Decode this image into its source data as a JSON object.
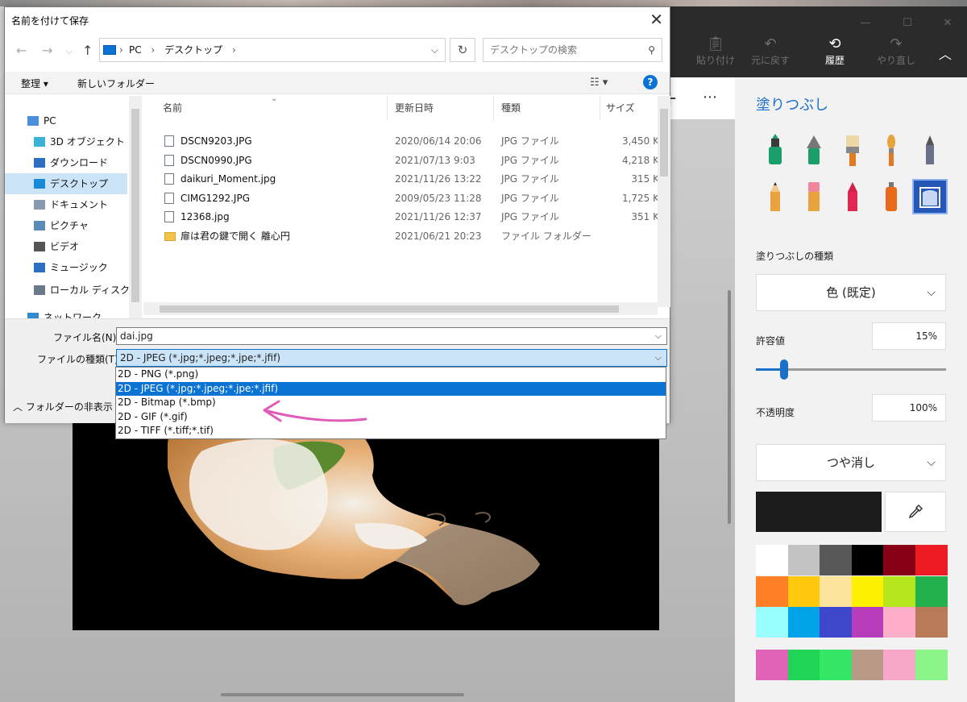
{
  "dialog": {
    "title": "名前を付けて保存",
    "address": [
      "PC",
      "デスクトップ"
    ],
    "search_placeholder": "デスクトップの検索",
    "commands": {
      "organize": "整理 ▾",
      "new_folder": "新しいフォルダー"
    },
    "nav_items": [
      {
        "label": "PC",
        "icon": "pc-icon"
      },
      {
        "label": "3D オブジェクト",
        "icon": "3d-objects-icon"
      },
      {
        "label": "ダウンロード",
        "icon": "download-icon"
      },
      {
        "label": "デスクトップ",
        "icon": "desktop-icon",
        "selected": true
      },
      {
        "label": "ドキュメント",
        "icon": "document-icon"
      },
      {
        "label": "ピクチャ",
        "icon": "pictures-icon"
      },
      {
        "label": "ビデオ",
        "icon": "video-icon"
      },
      {
        "label": "ミュージック",
        "icon": "music-icon"
      },
      {
        "label": "ローカル ディスク (C",
        "icon": "disk-icon"
      },
      {
        "label": "ネットワーク",
        "icon": "network-icon"
      }
    ],
    "columns": {
      "name": "名前",
      "modified": "更新日時",
      "type": "種類",
      "size": "サイズ"
    },
    "files": [
      {
        "name": "DSCN9203.JPG",
        "modified": "2020/06/14 20:06",
        "type": "JPG ファイル",
        "size": "3,450 K"
      },
      {
        "name": "DSCN0990.JPG",
        "modified": "2021/07/13 9:03",
        "type": "JPG ファイル",
        "size": "4,218 K"
      },
      {
        "name": "daikuri_Moment.jpg",
        "modified": "2021/11/26 13:22",
        "type": "JPG ファイル",
        "size": "315 K"
      },
      {
        "name": "CIMG1292.JPG",
        "modified": "2009/05/23 11:28",
        "type": "JPG ファイル",
        "size": "1,725 K"
      },
      {
        "name": "12368.jpg",
        "modified": "2021/11/26 12:37",
        "type": "JPG ファイル",
        "size": "351 K"
      },
      {
        "name": "扉は君の鍵で開く 離心円",
        "modified": "2021/06/21 20:23",
        "type": "ファイル フォルダー",
        "size": "",
        "folder": true
      }
    ],
    "filename_label": "ファイル名(N):",
    "filename_value": "dai.jpg",
    "filetype_label": "ファイルの種類(T):",
    "filetype_value": "2D - JPEG (*.jpg;*.jpeg;*.jpe;*.jfif)",
    "filetype_options": [
      "2D - PNG (*.png)",
      "2D - JPEG (*.jpg;*.jpeg;*.jpe;*.jfif)",
      "2D - Bitmap (*.bmp)",
      "2D - GIF (*.gif)",
      "2D - TIFF (*.tiff;*.tif)"
    ],
    "filetype_selected_index": 1,
    "hide_folders": "フォルダーの非表示"
  },
  "toolbar": {
    "paste": "貼り付け",
    "undo": "元に戻す",
    "history": "履歴",
    "redo": "やり直し"
  },
  "panel": {
    "title": "塗りつぶし",
    "fill_type_label": "塗りつぶしの種類",
    "fill_type_value": "色 (既定)",
    "tolerance_label": "許容値",
    "tolerance_value": "15%",
    "tolerance_level": 0.15,
    "opacity_label": "不透明度",
    "opacity_value": "100%",
    "finish_value": "つや消し",
    "current_color": "#1c1c1c",
    "palette": [
      "#ffffff",
      "#c3c3c3",
      "#585858",
      "#000000",
      "#880015",
      "#ed1c24",
      "#ff7f27",
      "#ffc90e",
      "#fde49c",
      "#fff200",
      "#b5e61d",
      "#22b14c",
      "#99ffff",
      "#00a2e8",
      "#3f48cc",
      "#b83dba",
      "#ffaec9",
      "#b97a57"
    ],
    "custom_palette": [
      "#e063b8",
      "#20d456",
      "#34e866",
      "#b89a86",
      "#f7a8c8",
      "#8cf58a"
    ]
  },
  "accent": "#1a6fc8"
}
